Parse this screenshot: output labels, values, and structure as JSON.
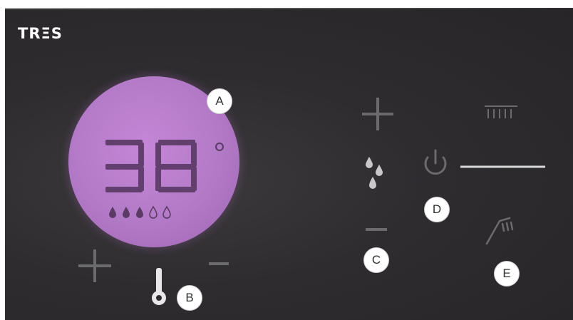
{
  "brand": {
    "logo_text": "TRΞS"
  },
  "display": {
    "temperature": "38",
    "unit_symbol": "°",
    "flow_level": 3,
    "flow_max": 5,
    "accent_color": "#b57bc9"
  },
  "callouts": {
    "a": "A",
    "b": "B",
    "c": "C",
    "d": "D",
    "e": "E"
  },
  "icons": {
    "temp_plus": "plus-icon",
    "temp_minus": "minus-icon",
    "thermometer": "thermometer-icon",
    "flow_plus": "plus-icon",
    "flow_minus": "minus-icon",
    "water_drops": "water-drops-icon",
    "power": "power-icon",
    "rain_shower": "rain-shower-icon",
    "hand_shower": "hand-shower-icon"
  },
  "colors": {
    "panel": "#2e2c2f",
    "control_gray": "#6b6a6c",
    "power_line": "#d9d9d9"
  }
}
